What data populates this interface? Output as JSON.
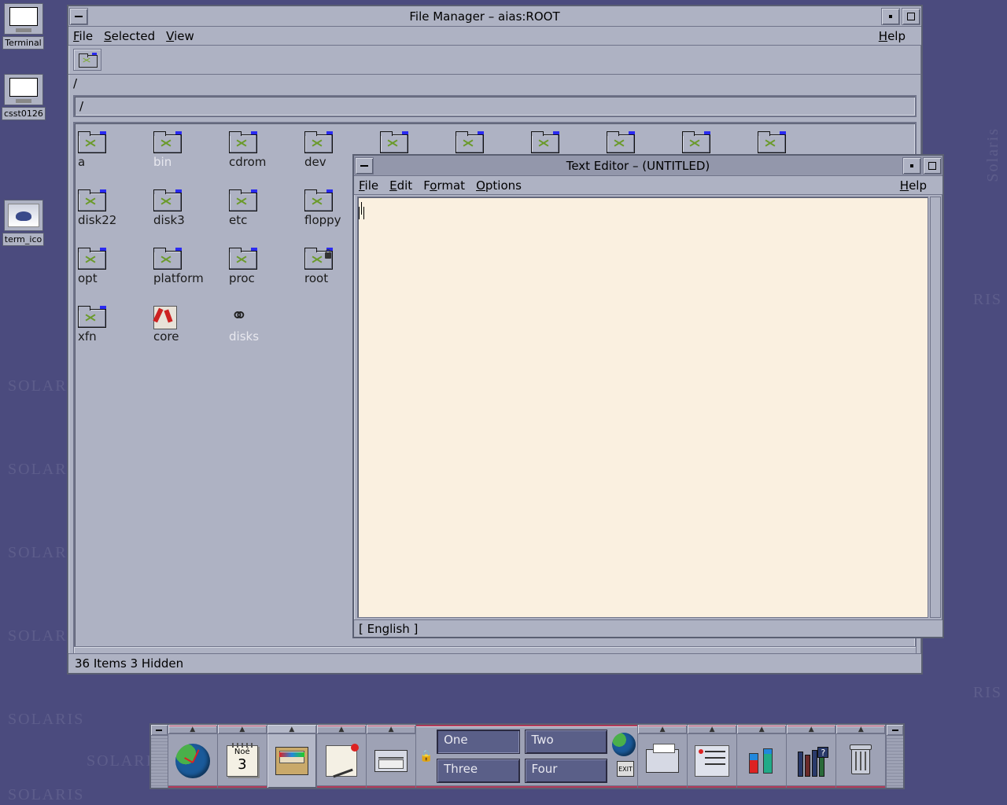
{
  "desktop_icons": [
    {
      "label": "Terminal",
      "kind": "monitor"
    },
    {
      "label": "csst0126",
      "kind": "monitor"
    },
    {
      "label": "term_ico",
      "kind": "teapot"
    }
  ],
  "watermark_text": "SOLARIS",
  "file_manager": {
    "title": "File Manager – aias:ROOT",
    "menus": {
      "file": "File",
      "selected": "Selected",
      "view": "View",
      "help": "Help"
    },
    "path_display": "/",
    "path_input": "/",
    "status": "36 Items 3 Hidden",
    "items": [
      {
        "label": "a",
        "type": "folder"
      },
      {
        "label": "bin",
        "type": "folder",
        "dim": true
      },
      {
        "label": "cdrom",
        "type": "folder"
      },
      {
        "label": "dev",
        "type": "folder"
      },
      {
        "label": "",
        "type": "folder"
      },
      {
        "label": "",
        "type": "folder"
      },
      {
        "label": "",
        "type": "folder"
      },
      {
        "label": "",
        "type": "folder"
      },
      {
        "label": "",
        "type": "folder"
      },
      {
        "label": "",
        "type": "folder"
      },
      {
        "label": "disk22",
        "type": "folder"
      },
      {
        "label": "disk3",
        "type": "folder"
      },
      {
        "label": "etc",
        "type": "folder"
      },
      {
        "label": "floppy",
        "type": "folder"
      },
      {
        "label": "opt",
        "type": "folder"
      },
      {
        "label": "platform",
        "type": "folder"
      },
      {
        "label": "proc",
        "type": "folder"
      },
      {
        "label": "root",
        "type": "folder",
        "locked": true
      },
      {
        "label": "xfn",
        "type": "folder"
      },
      {
        "label": "core",
        "type": "core"
      },
      {
        "label": "disks",
        "type": "link",
        "dim": true
      }
    ]
  },
  "text_editor": {
    "title": "Text Editor – (UNTITLED)",
    "menus": {
      "file": "File",
      "edit": "Edit",
      "format": "Format",
      "options": "Options",
      "help": "Help"
    },
    "content": "",
    "status": "[ English ]"
  },
  "front_panel": {
    "calendar": {
      "month": "Noé",
      "day": "3"
    },
    "workspaces": [
      "One",
      "Two",
      "Three",
      "Four"
    ],
    "active_workspace": 0,
    "exit_label": "EXIT",
    "help_q": "?"
  }
}
